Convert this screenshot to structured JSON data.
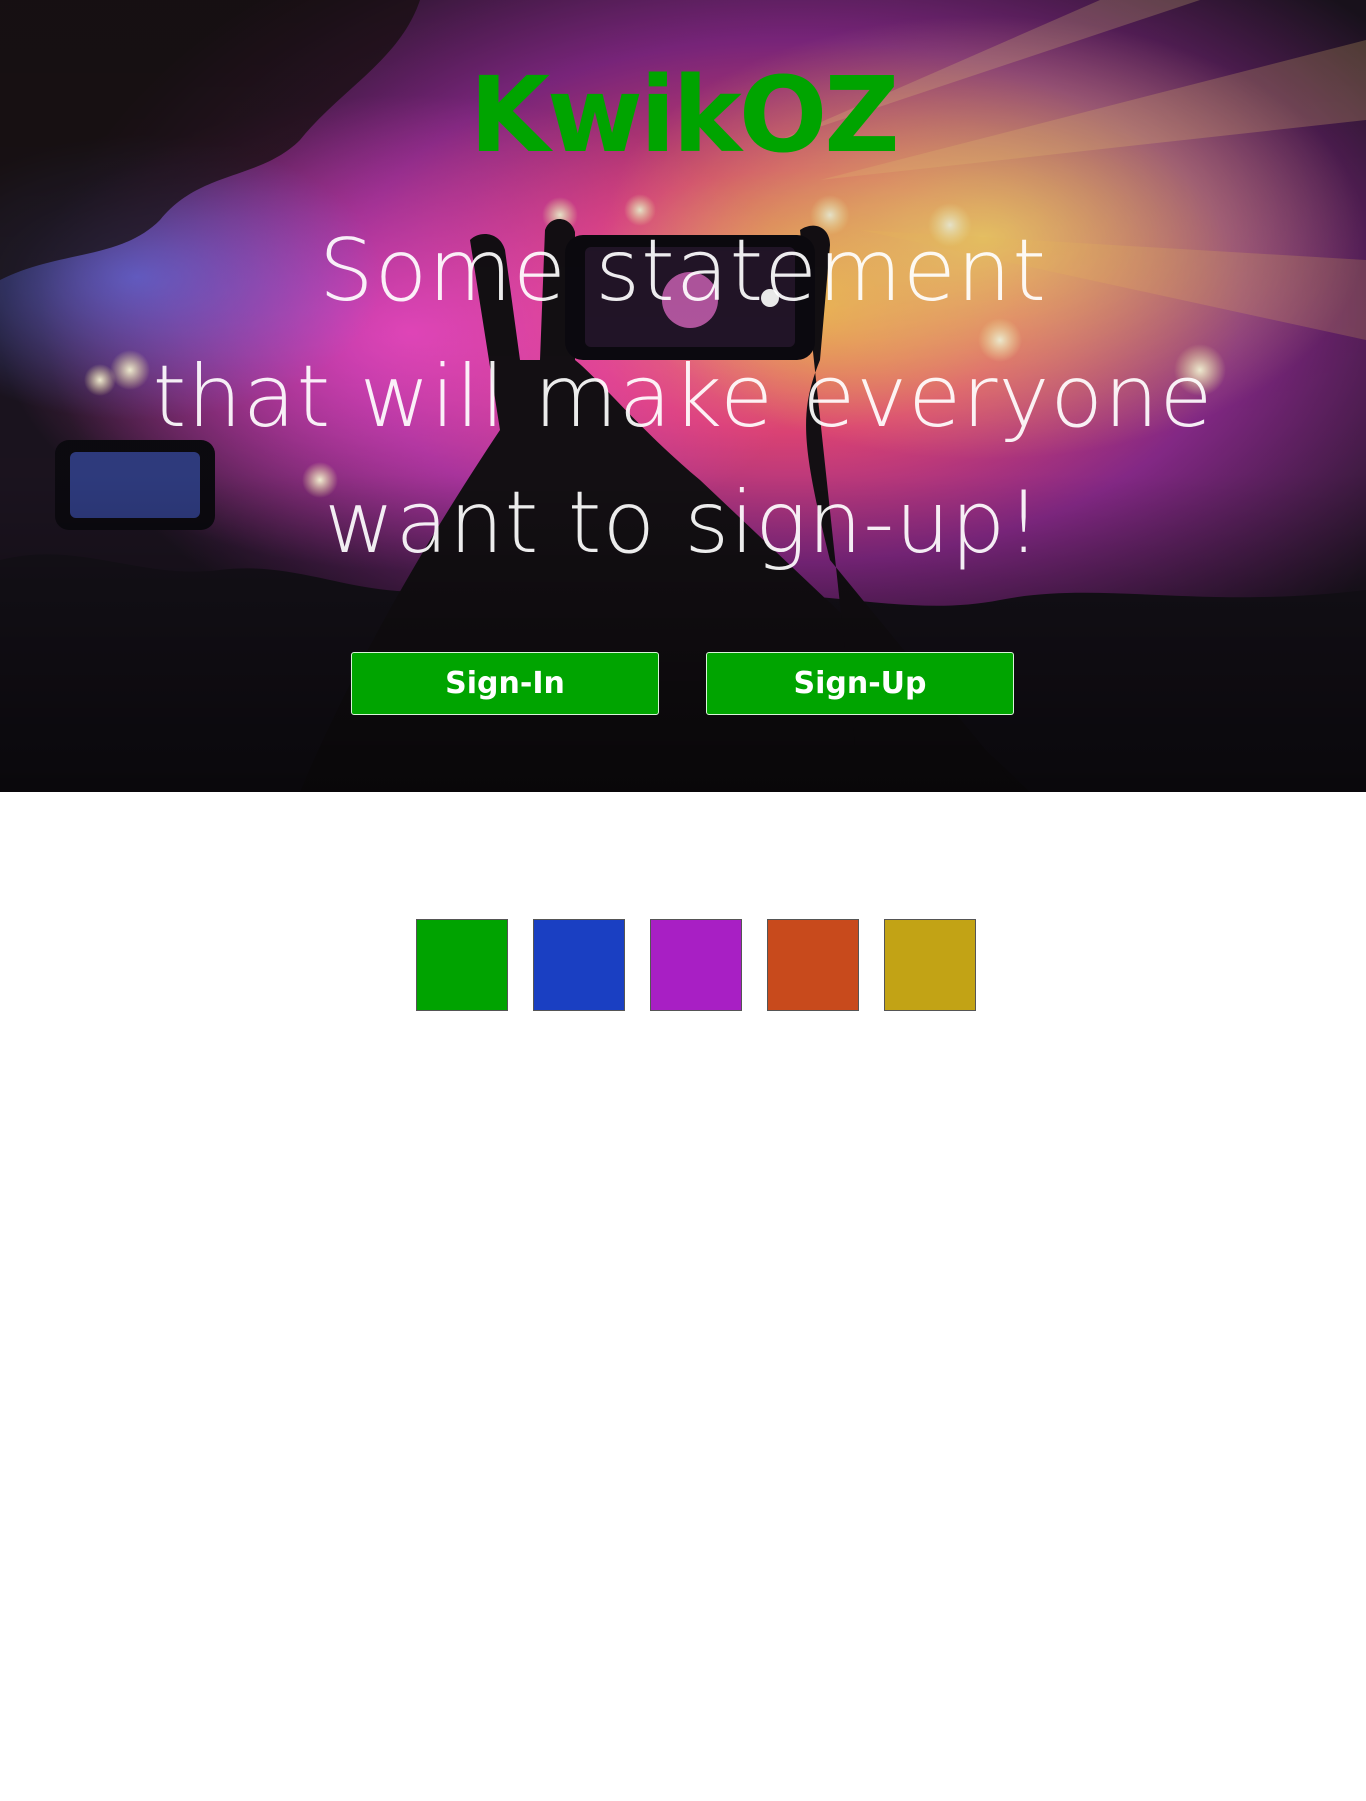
{
  "brand": {
    "name": "KwikOZ",
    "color": "#00a400"
  },
  "hero": {
    "statement_lines": [
      "Some statement",
      "that will make everyone",
      "want to sign-up!"
    ]
  },
  "actions": {
    "sign_in_label": "Sign-In",
    "sign_up_label": "Sign-Up",
    "button_color": "#00a400"
  },
  "theme_swatches": [
    {
      "name": "green",
      "color": "#00a300"
    },
    {
      "name": "blue",
      "color": "#1a3fc2"
    },
    {
      "name": "purple",
      "color": "#a81fc4"
    },
    {
      "name": "orange",
      "color": "#c84a1c"
    },
    {
      "name": "gold",
      "color": "#c2a315"
    }
  ]
}
